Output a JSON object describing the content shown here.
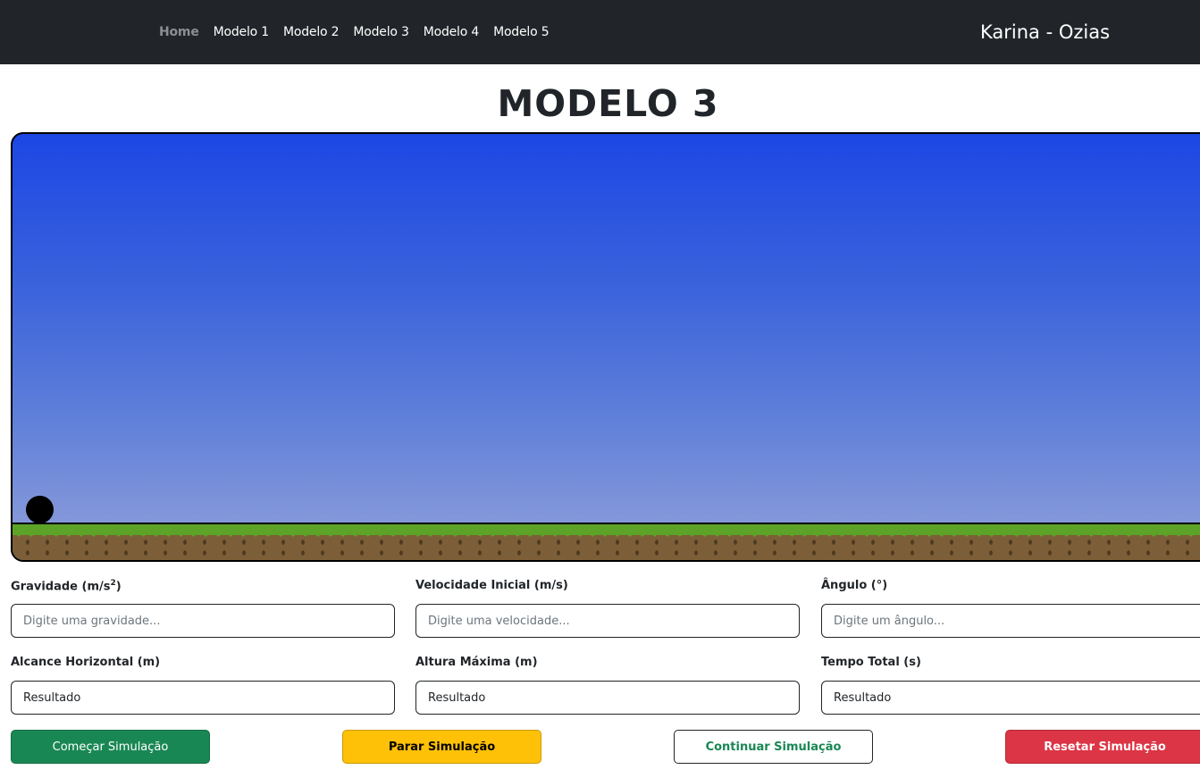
{
  "navbar": {
    "links": [
      "Home",
      "Modelo 1",
      "Modelo 2",
      "Modelo 3",
      "Modelo 4",
      "Modelo 5"
    ],
    "active_link": "Home",
    "brand": "Karina - Ozias"
  },
  "page": {
    "title": "MODELO 3"
  },
  "form": {
    "gravity": {
      "label": "Gravidade (m/s",
      "label_sup": "2",
      "label_end": ")",
      "placeholder": "Digite uma gravidade..."
    },
    "velocity": {
      "label": "Velocidade Inicial (m/s)",
      "placeholder": "Digite uma velocidade..."
    },
    "angle": {
      "label": "Ângulo (°)",
      "placeholder": "Digite um ângulo..."
    },
    "range": {
      "label": "Alcance Horizontal (m)",
      "value": "Resultado"
    },
    "max_height": {
      "label": "Altura Máxima (m)",
      "value": "Resultado"
    },
    "total_time": {
      "label": "Tempo Total (s)",
      "value": "Resultado"
    }
  },
  "buttons": {
    "start": "Começar Simulação",
    "stop": "Parar Simulação",
    "continue": "Continuar Simulação",
    "reset": "Resetar Simulação"
  },
  "colors": {
    "navbar_bg": "#212529",
    "sky_top": "#1c47e4",
    "sky_bottom": "#8598d9",
    "grass": "#5ca328",
    "dirt": "#7c5f38",
    "success": "#198754",
    "warning": "#ffc107",
    "danger": "#dc3545"
  }
}
